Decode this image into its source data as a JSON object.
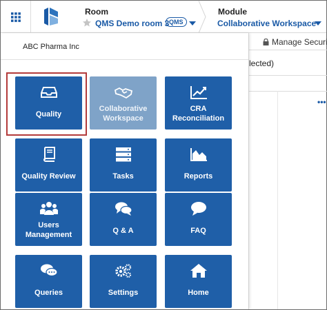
{
  "header": {
    "room_label": "Room",
    "room_name": "QMS Demo room 3",
    "room_badge": "QMS",
    "module_label": "Module",
    "module_name": "Collaborative Workspace"
  },
  "panel": {
    "org_name": "ABC Pharma Inc",
    "tiles": [
      {
        "label_lines": [
          "Quality"
        ],
        "icon": "inbox-icon",
        "selected": true
      },
      {
        "label_lines": [
          "Collaborative",
          "Workspace"
        ],
        "icon": "handshake-icon",
        "disabled": true
      },
      {
        "label_lines": [
          "CRA",
          "Reconciliation"
        ],
        "icon": "line-chart-icon"
      },
      {
        "label_lines": [
          "Quality Review"
        ],
        "icon": "book-icon"
      },
      {
        "label_lines": [
          "Tasks"
        ],
        "icon": "server-icon"
      },
      {
        "label_lines": [
          "Reports"
        ],
        "icon": "area-chart-icon"
      },
      {
        "label_lines": [
          "Users",
          "Management"
        ],
        "icon": "users-icon"
      },
      {
        "label_lines": [
          "Q & A"
        ],
        "icon": "comments-icon"
      },
      {
        "label_lines": [
          "FAQ"
        ],
        "icon": "comment-icon"
      },
      {
        "label_lines": [
          "Queries"
        ],
        "icon": "chat-icon"
      },
      {
        "label_lines": [
          "Settings"
        ],
        "icon": "cogs-icon"
      },
      {
        "label_lines": [
          "Home"
        ],
        "icon": "home-icon"
      }
    ]
  },
  "background": {
    "manage_security": "Manage Security",
    "selected_text": "lected)",
    "more_label": "•••"
  },
  "colors": {
    "tile_blue": "#1f5fa8",
    "tile_disabled": "#7fa3c8",
    "accent_text": "#1a5aa6",
    "selection_outline": "#b33a3a"
  }
}
